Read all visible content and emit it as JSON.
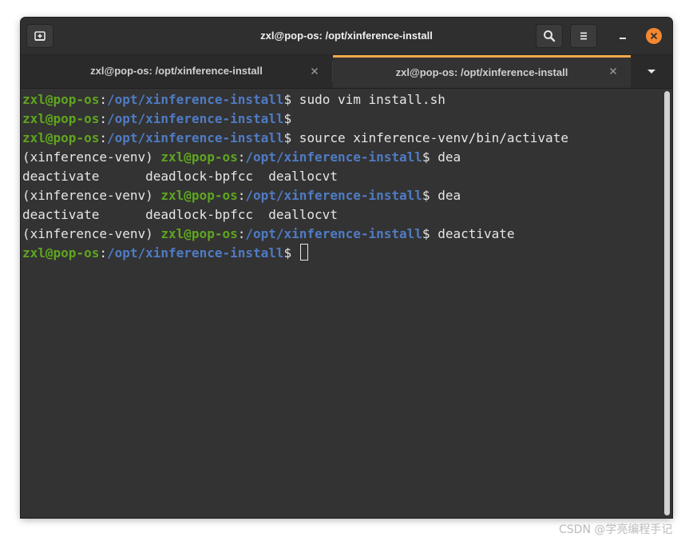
{
  "window": {
    "title": "zxl@pop-os: /opt/xinference-install"
  },
  "headerbar": {
    "new_tab_icon": "new-tab-icon",
    "search_icon": "search-icon",
    "menu_icon": "hamburger-menu-icon",
    "minimize_icon": "minimize-icon",
    "close_icon": "close-icon"
  },
  "tabs": [
    {
      "label": "zxl@pop-os: /opt/xinference-install",
      "close": "×",
      "active": false
    },
    {
      "label": "zxl@pop-os: /opt/xinference-install",
      "close": "×",
      "active": true
    }
  ],
  "terminal": {
    "lines": [
      {
        "venv": "",
        "user": "zxl@pop-os",
        "sep": ":",
        "path": "/opt/xinference-install",
        "sigil": "$",
        "cmd": " sudo vim install.sh"
      },
      {
        "venv": "",
        "user": "zxl@pop-os",
        "sep": ":",
        "path": "/opt/xinference-install",
        "sigil": "$",
        "cmd": ""
      },
      {
        "venv": "",
        "user": "zxl@pop-os",
        "sep": ":",
        "path": "/opt/xinference-install",
        "sigil": "$",
        "cmd": " source xinference-venv/bin/activate"
      },
      {
        "venv": "(xinference-venv) ",
        "user": "zxl@pop-os",
        "sep": ":",
        "path": "/opt/xinference-install",
        "sigil": "$",
        "cmd": " dea"
      },
      {
        "text": "deactivate      deadlock-bpfcc  deallocvt"
      },
      {
        "venv": "(xinference-venv) ",
        "user": "zxl@pop-os",
        "sep": ":",
        "path": "/opt/xinference-install",
        "sigil": "$",
        "cmd": " dea"
      },
      {
        "text": "deactivate      deadlock-bpfcc  deallocvt"
      },
      {
        "venv": "(xinference-venv) ",
        "user": "zxl@pop-os",
        "sep": ":",
        "path": "/opt/xinference-install",
        "sigil": "$",
        "cmd": " deactivate"
      },
      {
        "venv": "",
        "user": "zxl@pop-os",
        "sep": ":",
        "path": "/opt/xinference-install",
        "sigil": "$",
        "cmd": " "
      }
    ]
  },
  "colors": {
    "accent": "#f4a84b",
    "close_button": "#f4872e",
    "prompt_user": "#5fa51f",
    "prompt_path": "#4f7bc4",
    "background": "#333333"
  },
  "watermark": "CSDN @学亮编程手记"
}
